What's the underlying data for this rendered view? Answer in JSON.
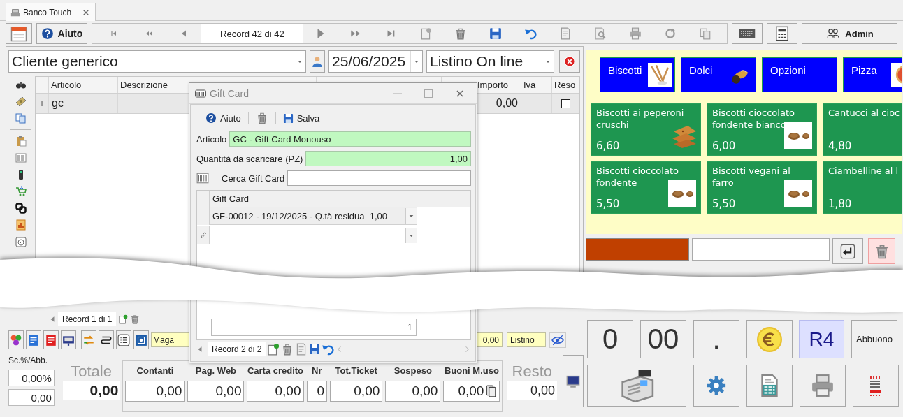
{
  "tab": {
    "label": "Banco Touch"
  },
  "toolbar": {
    "help": "Aiuto",
    "record": "Record 42 di 42",
    "user": "Admin"
  },
  "header": {
    "customer": "Cliente generico",
    "date": "25/06/2025",
    "price_list": "Listino On line"
  },
  "grid": {
    "columns": [
      "Articolo",
      "Descrizione",
      "Importo",
      "Iva",
      "Reso"
    ],
    "rows": [
      {
        "indicator": "I",
        "article": "gc",
        "amount": "0,00",
        "returned": false
      }
    ],
    "navigator": "Record 1 di 1"
  },
  "categories": [
    {
      "label": "Biscotti",
      "picture": true
    },
    {
      "label": "Dolci",
      "picture": true
    },
    {
      "label": "Opzioni",
      "picture": false
    },
    {
      "label": "Pizza",
      "picture": true
    }
  ],
  "products": [
    {
      "name": "Biscotti ai peperoni cruschi",
      "price": "6,60",
      "picture": true
    },
    {
      "name": "Biscotti cioccolato fondente bianco",
      "price": "6,00",
      "picture": true
    },
    {
      "name": "Cantucci al cioc",
      "price": "4,80",
      "picture": false
    },
    {
      "name": "Biscotti cioccolato fondente",
      "price": "5,50",
      "picture": true
    },
    {
      "name": "Biscotti vegani al farro",
      "price": "5,50",
      "picture": true
    },
    {
      "name": "Ciambelline al l",
      "price": "1,80",
      "picture": false
    }
  ],
  "dialog": {
    "title": "Gift Card",
    "help": "Aiuto",
    "save": "Salva",
    "article_label": "Articolo",
    "article": "GC - Gift Card Monouso",
    "qty_label": "Quantità da scaricare (PZ)",
    "qty": "1,00",
    "search_label": "Cerca Gift Card",
    "column": "Gift Card",
    "rows": [
      {
        "value": "GF-00012 - 19/12/2025 - Q.tà residua  1,00"
      }
    ],
    "new_row": true,
    "footer": "1",
    "navigator": "Record 2 di 2"
  },
  "bottom_bar": {
    "warehouse": "Maga",
    "amount": "0,00",
    "price_list": "Listino"
  },
  "totals": {
    "discount_label": "Sc.%/Abb.",
    "discount_percent": "0,00%",
    "discount_value": "0,00",
    "total_label": "Totale",
    "total": "0,00",
    "payments": [
      {
        "label": "Contanti",
        "value": "0,00",
        "kind": "plain"
      },
      {
        "label": "Pag. Web",
        "value": "0,00",
        "kind": "plain"
      },
      {
        "label": "Carta credito",
        "value": "0,00",
        "kind": "plain"
      },
      {
        "label": "Nr",
        "value": "0",
        "kind": "plain"
      },
      {
        "label": "Tot.Ticket",
        "value": "0,00",
        "kind": "plain"
      },
      {
        "label": "Sospeso",
        "value": "0,00",
        "kind": "plain"
      },
      {
        "label": "Buoni M.uso",
        "value": "0,00",
        "kind": "voucher"
      }
    ],
    "change_label": "Resto",
    "change": "0,00"
  },
  "keypad": [
    [
      {
        "kind": "text",
        "label": "0",
        "highlighted": false
      },
      {
        "kind": "text",
        "label": "00",
        "highlighted": false
      },
      {
        "kind": "text",
        "label": ".",
        "highlighted": false
      },
      {
        "kind": "coin",
        "highlighted": false
      },
      {
        "kind": "text",
        "label": "R4",
        "highlighted": true
      },
      {
        "kind": "small",
        "label": "Abbuono",
        "highlighted": false
      }
    ],
    [
      {
        "kind": "register",
        "highlighted": false
      },
      {
        "kind": "gear",
        "highlighted": false
      },
      {
        "kind": "sheet",
        "highlighted": false
      },
      {
        "kind": "printer",
        "highlighted": false
      },
      {
        "kind": "receipt",
        "highlighted": false
      }
    ]
  ]
}
